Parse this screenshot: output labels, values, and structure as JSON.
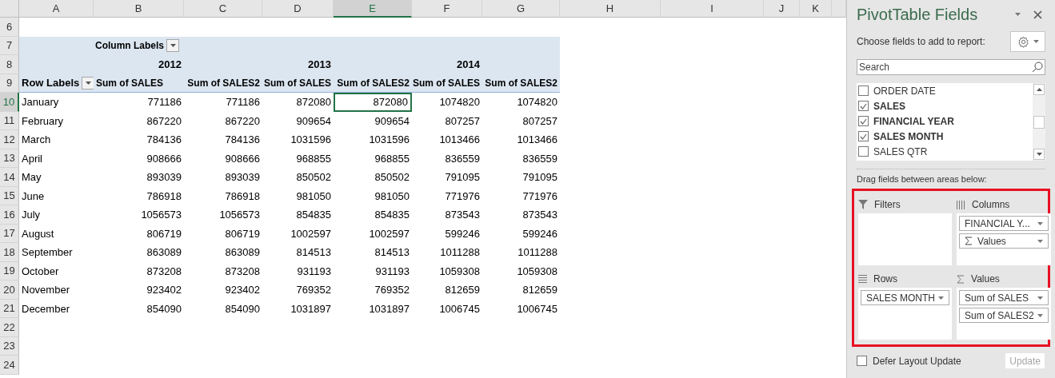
{
  "sheet": {
    "columns": [
      {
        "label": "A",
        "selected": false
      },
      {
        "label": "B",
        "selected": false
      },
      {
        "label": "C",
        "selected": false
      },
      {
        "label": "D",
        "selected": false
      },
      {
        "label": "E",
        "selected": true
      },
      {
        "label": "F",
        "selected": false
      },
      {
        "label": "G",
        "selected": false
      },
      {
        "label": "H",
        "selected": false
      },
      {
        "label": "I",
        "selected": false
      },
      {
        "label": "J",
        "selected": false
      },
      {
        "label": "K",
        "selected": false
      }
    ],
    "row_numbers": [
      {
        "label": "6",
        "selected": false
      },
      {
        "label": "7",
        "selected": false
      },
      {
        "label": "8",
        "selected": false
      },
      {
        "label": "9",
        "selected": false
      },
      {
        "label": "10",
        "selected": true
      },
      {
        "label": "11",
        "selected": false
      },
      {
        "label": "12",
        "selected": false
      },
      {
        "label": "13",
        "selected": false
      },
      {
        "label": "14",
        "selected": false
      },
      {
        "label": "15",
        "selected": false
      },
      {
        "label": "16",
        "selected": false
      },
      {
        "label": "17",
        "selected": false
      },
      {
        "label": "18",
        "selected": false
      },
      {
        "label": "19",
        "selected": false
      },
      {
        "label": "20",
        "selected": false
      },
      {
        "label": "21",
        "selected": false
      },
      {
        "label": "22",
        "selected": false
      },
      {
        "label": "23",
        "selected": false
      },
      {
        "label": "24",
        "selected": false
      }
    ],
    "pivot": {
      "column_labels": "Column Labels",
      "years": [
        "2012",
        "2013",
        "2014"
      ],
      "row_labels": "Row Labels",
      "value_headers": [
        "Sum of SALES",
        "Sum of SALES2",
        "Sum of SALES",
        "Sum of SALES2",
        "Sum of SALES",
        "Sum of SALES2"
      ],
      "rows": [
        {
          "label": "January",
          "cells": [
            {
              "text": "771186",
              "selected": false
            },
            {
              "text": "771186",
              "selected": false
            },
            {
              "text": "872080",
              "selected": false
            },
            {
              "text": "872080",
              "selected": true
            },
            {
              "text": "1074820",
              "selected": false
            },
            {
              "text": "1074820",
              "selected": false
            }
          ]
        },
        {
          "label": "February",
          "cells": [
            {
              "text": "867220",
              "selected": false
            },
            {
              "text": "867220",
              "selected": false
            },
            {
              "text": "909654",
              "selected": false
            },
            {
              "text": "909654",
              "selected": false
            },
            {
              "text": "807257",
              "selected": false
            },
            {
              "text": "807257",
              "selected": false
            }
          ]
        },
        {
          "label": "March",
          "cells": [
            {
              "text": "784136",
              "selected": false
            },
            {
              "text": "784136",
              "selected": false
            },
            {
              "text": "1031596",
              "selected": false
            },
            {
              "text": "1031596",
              "selected": false
            },
            {
              "text": "1013466",
              "selected": false
            },
            {
              "text": "1013466",
              "selected": false
            }
          ]
        },
        {
          "label": "April",
          "cells": [
            {
              "text": "908666",
              "selected": false
            },
            {
              "text": "908666",
              "selected": false
            },
            {
              "text": "968855",
              "selected": false
            },
            {
              "text": "968855",
              "selected": false
            },
            {
              "text": "836559",
              "selected": false
            },
            {
              "text": "836559",
              "selected": false
            }
          ]
        },
        {
          "label": "May",
          "cells": [
            {
              "text": "893039",
              "selected": false
            },
            {
              "text": "893039",
              "selected": false
            },
            {
              "text": "850502",
              "selected": false
            },
            {
              "text": "850502",
              "selected": false
            },
            {
              "text": "791095",
              "selected": false
            },
            {
              "text": "791095",
              "selected": false
            }
          ]
        },
        {
          "label": "June",
          "cells": [
            {
              "text": "786918",
              "selected": false
            },
            {
              "text": "786918",
              "selected": false
            },
            {
              "text": "981050",
              "selected": false
            },
            {
              "text": "981050",
              "selected": false
            },
            {
              "text": "771976",
              "selected": false
            },
            {
              "text": "771976",
              "selected": false
            }
          ]
        },
        {
          "label": "July",
          "cells": [
            {
              "text": "1056573",
              "selected": false
            },
            {
              "text": "1056573",
              "selected": false
            },
            {
              "text": "854835",
              "selected": false
            },
            {
              "text": "854835",
              "selected": false
            },
            {
              "text": "873543",
              "selected": false
            },
            {
              "text": "873543",
              "selected": false
            }
          ]
        },
        {
          "label": "August",
          "cells": [
            {
              "text": "806719",
              "selected": false
            },
            {
              "text": "806719",
              "selected": false
            },
            {
              "text": "1002597",
              "selected": false
            },
            {
              "text": "1002597",
              "selected": false
            },
            {
              "text": "599246",
              "selected": false
            },
            {
              "text": "599246",
              "selected": false
            }
          ]
        },
        {
          "label": "September",
          "cells": [
            {
              "text": "863089",
              "selected": false
            },
            {
              "text": "863089",
              "selected": false
            },
            {
              "text": "814513",
              "selected": false
            },
            {
              "text": "814513",
              "selected": false
            },
            {
              "text": "1011288",
              "selected": false
            },
            {
              "text": "1011288",
              "selected": false
            }
          ]
        },
        {
          "label": "October",
          "cells": [
            {
              "text": "873208",
              "selected": false
            },
            {
              "text": "873208",
              "selected": false
            },
            {
              "text": "931193",
              "selected": false
            },
            {
              "text": "931193",
              "selected": false
            },
            {
              "text": "1059308",
              "selected": false
            },
            {
              "text": "1059308",
              "selected": false
            }
          ]
        },
        {
          "label": "November",
          "cells": [
            {
              "text": "923402",
              "selected": false
            },
            {
              "text": "923402",
              "selected": false
            },
            {
              "text": "769352",
              "selected": false
            },
            {
              "text": "769352",
              "selected": false
            },
            {
              "text": "812659",
              "selected": false
            },
            {
              "text": "812659",
              "selected": false
            }
          ]
        },
        {
          "label": "December",
          "cells": [
            {
              "text": "854090",
              "selected": false
            },
            {
              "text": "854090",
              "selected": false
            },
            {
              "text": "1031897",
              "selected": false
            },
            {
              "text": "1031897",
              "selected": false
            },
            {
              "text": "1006745",
              "selected": false
            },
            {
              "text": "1006745",
              "selected": false
            }
          ]
        }
      ]
    }
  },
  "panel": {
    "title": "PivotTable Fields",
    "subtitle": "Choose fields to add to report:",
    "search": {
      "placeholder": "Search"
    },
    "fields": [
      {
        "label": "ORDER DATE",
        "checked": false
      },
      {
        "label": "SALES",
        "checked": true
      },
      {
        "label": "FINANCIAL YEAR",
        "checked": true
      },
      {
        "label": "SALES MONTH",
        "checked": true
      },
      {
        "label": "SALES QTR",
        "checked": false
      }
    ],
    "areas_caption": "Drag fields between areas below:",
    "areas_highlighted": true,
    "areas": [
      {
        "kind": "filters",
        "title": "Filters"
      },
      {
        "kind": "columns",
        "title": "Columns",
        "items": [
          "FINANCIAL Y...",
          "Values"
        ]
      },
      {
        "kind": "rows",
        "title": "Rows",
        "items": [
          "SALES MONTH"
        ]
      },
      {
        "kind": "values",
        "title": "Values",
        "items": [
          "Sum of SALES",
          "Sum of SALES2"
        ]
      }
    ],
    "defer": {
      "label": "Defer Layout Update",
      "checked": false
    },
    "update": {
      "label": "Update",
      "disabled": true
    }
  }
}
